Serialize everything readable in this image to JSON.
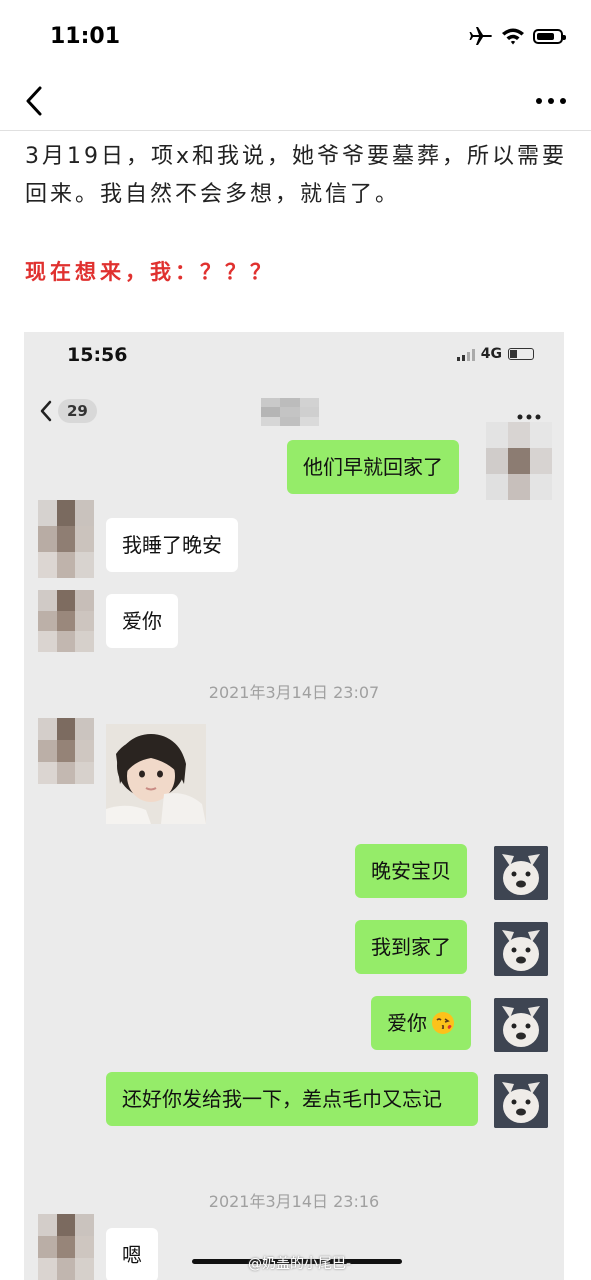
{
  "status_bar": {
    "time": "11:01",
    "icons": [
      "airplane-icon",
      "wifi-icon",
      "battery-icon"
    ]
  },
  "nav": {
    "back_icon": "chevron-left-icon",
    "more_icon": "ellipsis-icon"
  },
  "article": {
    "paragraph": "3月19日，项x和我说，她爷爷要墓葬，所以需要回来。我自然不会多想，就信了。",
    "highlight": "现在想来，我：？？？"
  },
  "screenshot": {
    "status_time": "15:56",
    "network": "4G",
    "unread_count": "29",
    "messages": [
      {
        "side": "out",
        "text": "他们早就回家了"
      },
      {
        "side": "in",
        "text": "我睡了晚安"
      },
      {
        "side": "in",
        "text": "爱你"
      },
      {
        "type": "timestamp",
        "text": "2021年3月14日 23:07"
      },
      {
        "side": "in",
        "type": "image",
        "description": "child-photo"
      },
      {
        "side": "out",
        "text": "晚安宝贝"
      },
      {
        "side": "out",
        "text": "我到家了"
      },
      {
        "side": "out",
        "text": "爱你",
        "emoji": "😘"
      },
      {
        "side": "out",
        "text": "还好你发给我一下，差点毛巾又忘记"
      },
      {
        "type": "timestamp",
        "text": "2021年3月14日 23:16"
      },
      {
        "side": "in",
        "text": "嗯"
      }
    ]
  },
  "watermark": "@奶盖的小尾巴-",
  "colors": {
    "highlight": "#e0312f",
    "out_bubble": "#95ec69",
    "in_bubble": "#ffffff",
    "chat_bg": "#ebebeb"
  }
}
